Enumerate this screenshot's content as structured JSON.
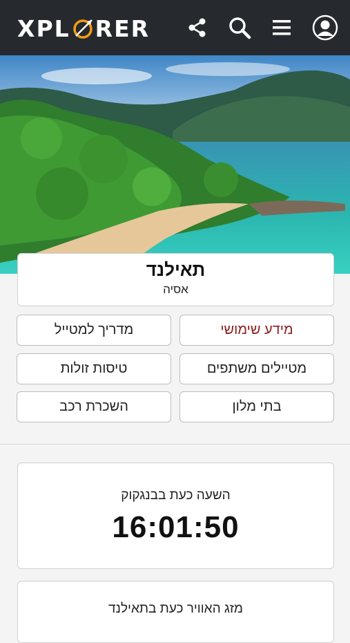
{
  "header": {
    "logo_text_left": "XPL",
    "logo_text_right": "RER",
    "icons": [
      "share-icon",
      "search-icon",
      "menu-icon",
      "user-icon"
    ],
    "bg_color": "#262a2e",
    "accent_color": "#f39c12"
  },
  "destination": {
    "name": "תאילנד",
    "region": "אסיה"
  },
  "menu": {
    "practical_info": "מידע שימושי",
    "travel_guide": "מדריך למטייל",
    "travel_partners": "מטיילים משתפים",
    "cheap_flights": "טיסות זולות",
    "hotels": "בתי מלון",
    "car_rental": "השכרת רכב"
  },
  "time_widget": {
    "label": "השעה כעת בבנגקוק",
    "time": "16:01:50"
  },
  "weather_widget": {
    "label": "מזג האוויר כעת בתאילנד"
  }
}
